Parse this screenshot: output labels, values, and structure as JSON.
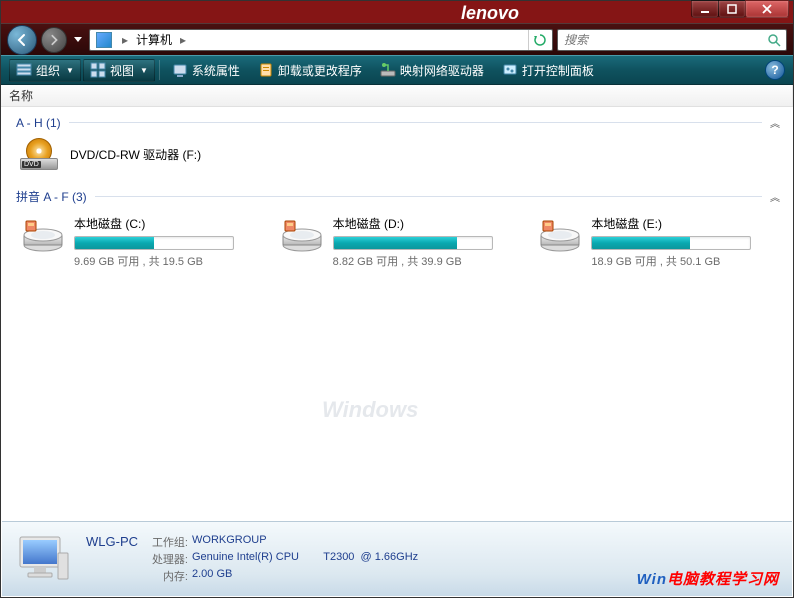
{
  "titlebar": {
    "brand": "lenovo"
  },
  "nav": {
    "crumb1": "计算机",
    "search_placeholder": "搜索"
  },
  "toolbar": {
    "organize": "组织",
    "views": "视图",
    "properties": "系统属性",
    "uninstall": "卸载或更改程序",
    "mapdrive": "映射网络驱动器",
    "controlpanel": "打开控制面板"
  },
  "columns": {
    "name": "名称"
  },
  "groups": [
    {
      "label": "A - H (1)",
      "type": "optical",
      "items": [
        {
          "name": "DVD/CD-RW 驱动器 (F:)"
        }
      ]
    },
    {
      "label": "拼音 A - F (3)",
      "type": "drives",
      "items": [
        {
          "name": "本地磁盘 (C:)",
          "free": "9.69 GB",
          "total": "19.5 GB",
          "used_pct": 50,
          "stats": "9.69 GB 可用 , 共 19.5 GB"
        },
        {
          "name": "本地磁盘 (D:)",
          "free": "8.82 GB",
          "total": "39.9 GB",
          "used_pct": 78,
          "stats": "8.82 GB 可用 , 共 39.9 GB"
        },
        {
          "name": "本地磁盘 (E:)",
          "free": "18.9 GB",
          "total": "50.1 GB",
          "used_pct": 62,
          "stats": "18.9 GB 可用 , 共 50.1 GB"
        }
      ]
    }
  ],
  "details": {
    "pcname": "WLG-PC",
    "workgroup_k": "工作组:",
    "workgroup_v": "WORKGROUP",
    "cpu_k": "处理器:",
    "cpu_v": "Genuine Intel(R) CPU        T2300  @ 1.66GHz",
    "mem_k": "内存:",
    "mem_v": "2.00 GB"
  },
  "watermark": {
    "a": "Win",
    "b": "电脑教程学习网"
  },
  "wm_center": "Windows"
}
